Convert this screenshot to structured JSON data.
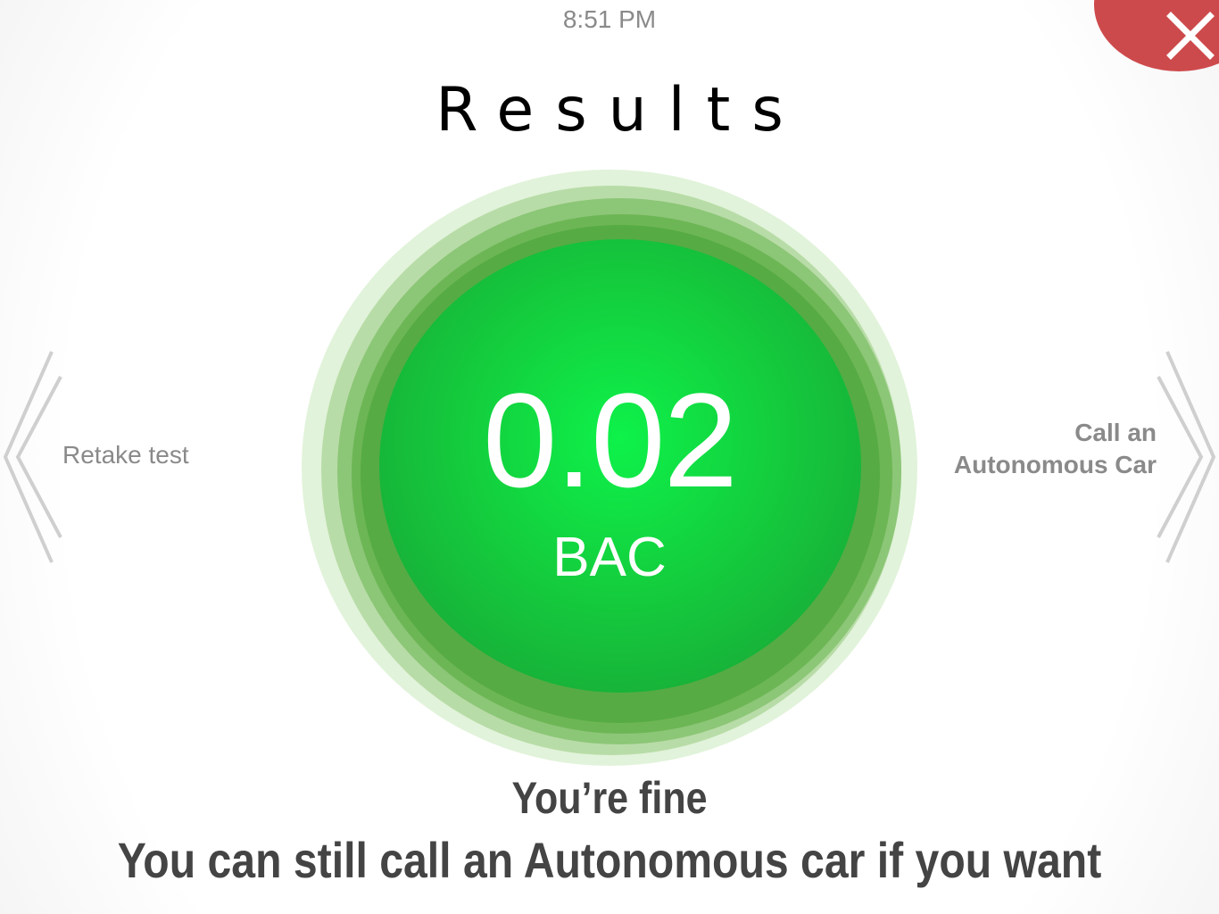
{
  "status_bar": {
    "time": "8:51 PM"
  },
  "header": {
    "title": "Results",
    "close_icon": "close-icon"
  },
  "result": {
    "value": "0.02",
    "unit": "BAC"
  },
  "navigation": {
    "prev_label": "Retake test",
    "prev_icon": "chevron-left-icon",
    "next_label_line1": "Call an",
    "next_label_line2": "Autonomous Car",
    "next_icon": "chevron-right-icon"
  },
  "message": {
    "headline": "You’re fine",
    "detail": "You can still call an Autonomous car if you want"
  },
  "colors": {
    "close_button": "#cd4a4c",
    "gauge_core": "#14cc3d",
    "text_dark": "#444444",
    "text_muted": "#8a8a8a"
  }
}
